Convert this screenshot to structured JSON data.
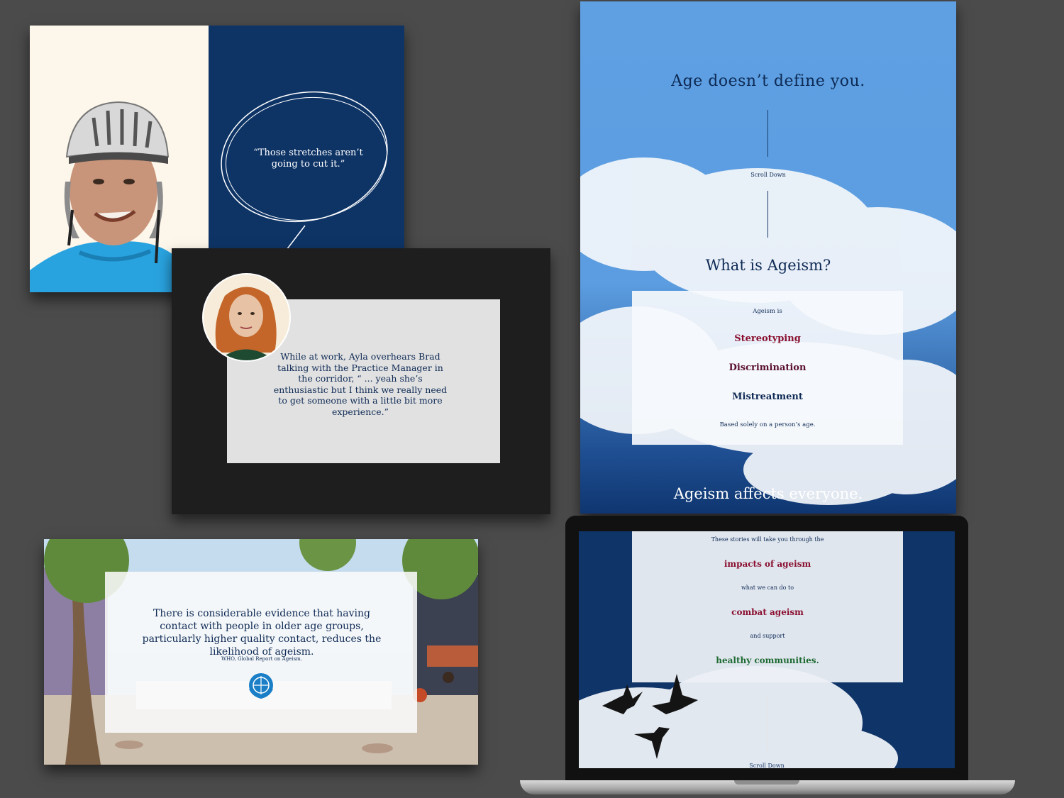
{
  "panel_quote": {
    "text": "“Those stretches aren’t going to cut it.”"
  },
  "panel_scenario": {
    "text": "While at work, Ayla overhears Brad talking with the Practice Manager in the corridor, “ ... yeah she’s enthusiastic but I think we really need to get someone with a little bit more experience.”"
  },
  "panel_evidence": {
    "text": "There is considerable evidence that having contact with people in older age groups, particularly higher quality contact, reduces the likelihood of ageism.",
    "citation": "WHO, Global Report on Ageism."
  },
  "panel_scroll": {
    "heading": "Age doesn’t define you.",
    "scroll_label": "Scroll Down",
    "question": "What is Ageism?",
    "card_intro": "Ageism is",
    "terms": [
      "Stereotyping",
      "Discrimination",
      "Mistreatment"
    ],
    "card_footer": "Based solely on a person’s age.",
    "bottom_heading": "Ageism affects everyone."
  },
  "laptop_screen": {
    "line1": "These stories will take you through the",
    "highlight1": "impacts of ageism",
    "line2": "what we can do to",
    "highlight2": "combat ageism",
    "line3": "and support",
    "highlight3": "healthy communities.",
    "scroll_label": "Scroll Down"
  },
  "colors": {
    "navy": "#0e2a55",
    "crimson": "#8a1030",
    "green": "#1e6a32",
    "sky": "#5ea0e2"
  }
}
